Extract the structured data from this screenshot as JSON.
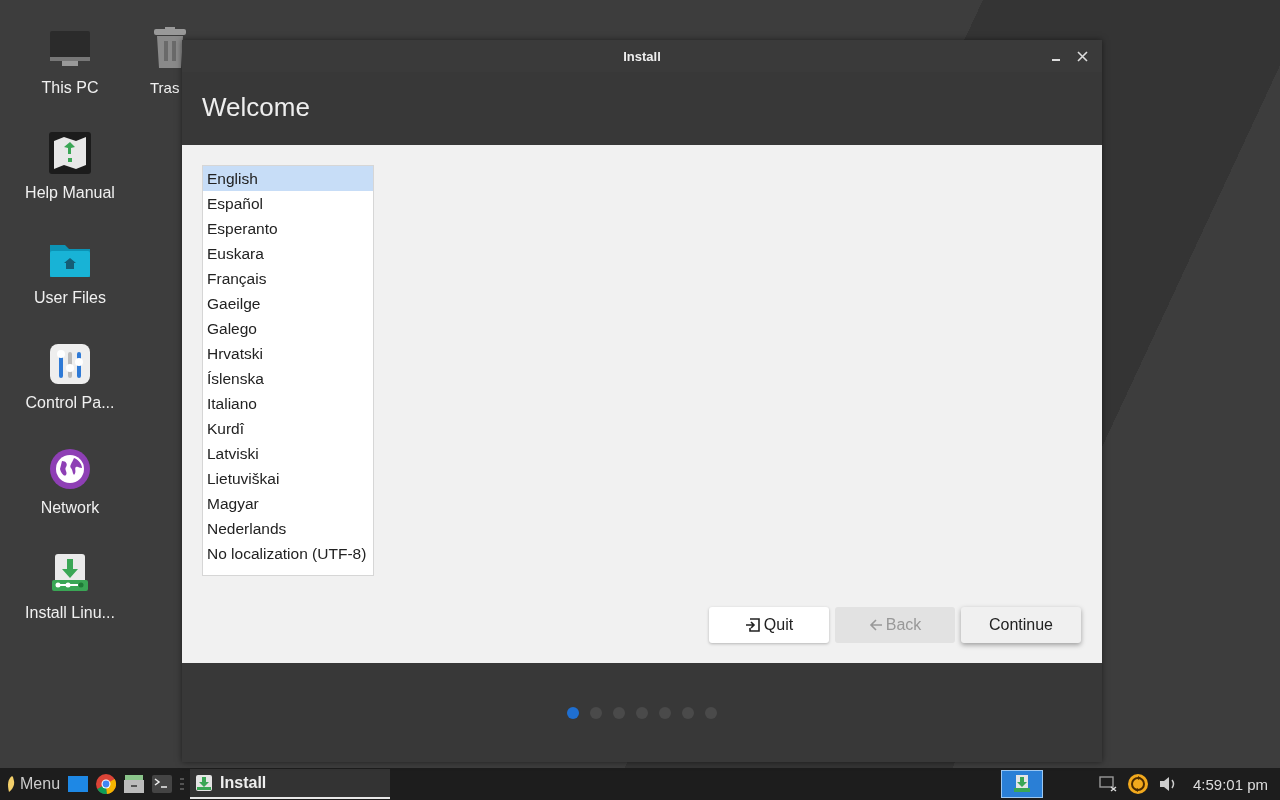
{
  "desktop": {
    "icons": [
      {
        "label": "This PC",
        "kind": "computer"
      },
      {
        "label": "Help Manual",
        "kind": "manual"
      },
      {
        "label": "User Files",
        "kind": "folder"
      },
      {
        "label": "Control Pa...",
        "kind": "control"
      },
      {
        "label": "Network",
        "kind": "network"
      },
      {
        "label": "Install Linu...",
        "kind": "installer"
      },
      {
        "label": "Tras",
        "kind": "trash"
      }
    ]
  },
  "window": {
    "title": "Install",
    "heading": "Welcome",
    "languages": [
      {
        "label": "English",
        "selected": true
      },
      {
        "label": "Español",
        "selected": false
      },
      {
        "label": "Esperanto",
        "selected": false
      },
      {
        "label": "Euskara",
        "selected": false
      },
      {
        "label": "Français",
        "selected": false
      },
      {
        "label": "Gaeilge",
        "selected": false
      },
      {
        "label": "Galego",
        "selected": false
      },
      {
        "label": "Hrvatski",
        "selected": false
      },
      {
        "label": "Íslenska",
        "selected": false
      },
      {
        "label": "Italiano",
        "selected": false
      },
      {
        "label": "Kurdî",
        "selected": false
      },
      {
        "label": "Latviski",
        "selected": false
      },
      {
        "label": "Lietuviškai",
        "selected": false
      },
      {
        "label": "Magyar",
        "selected": false
      },
      {
        "label": "Nederlands",
        "selected": false
      },
      {
        "label": "No localization (UTF-8)",
        "selected": false
      }
    ],
    "buttons": [
      {
        "label": "Quit",
        "kind": "quit",
        "disabled": false
      },
      {
        "label": "Back",
        "kind": "back",
        "disabled": true
      },
      {
        "label": "Continue",
        "kind": "continue",
        "disabled": false
      }
    ],
    "steps": [
      {
        "selected": true
      },
      {
        "selected": false
      },
      {
        "selected": false
      },
      {
        "selected": false
      },
      {
        "selected": false
      },
      {
        "selected": false
      },
      {
        "selected": false
      }
    ]
  },
  "taskbar": {
    "menu_label": "Menu",
    "tasks": [
      {
        "label": "Install",
        "selected": true
      }
    ],
    "clock": "4:59:01 pm"
  }
}
